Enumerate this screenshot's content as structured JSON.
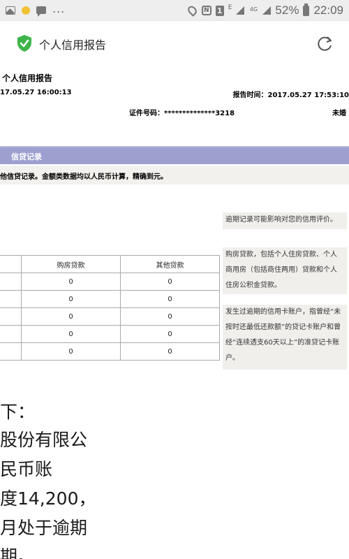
{
  "status_bar": {
    "battery_percent": "52%",
    "time": "22:09",
    "network": "4G",
    "extra_indicator": "E",
    "sim_indicator": "1",
    "more": "..."
  },
  "browser": {
    "page_title": "个人信用报告",
    "secure_color": "#3db54a"
  },
  "document": {
    "title": "个人信用报告",
    "query_time": "17.05.27 16:00:13",
    "report_time": "报告时间：2017.05.27 17:53:10",
    "id_number": "证件号码：**************3218",
    "marital_status": "未婚",
    "section_title": "信贷记录",
    "section_note": "他信贷记录。金额类数据均以人民币计算，精确到元。"
  },
  "side_notes": [
    "逾期记录可能影响对您的信用评价。",
    "购房贷款，包括个人住房贷款、个人商用房（包括商住两用）贷款和个人住房公积金贷款。",
    "发生过逾期的信用卡账户，指曾经“未按时还最低还款额”的贷记卡账户和曾经“连续透支60天以上”的准贷记卡账户。"
  ],
  "table": {
    "headers": [
      "",
      "购房贷款",
      "其他贷款"
    ],
    "rows": [
      [
        "",
        "0",
        "0"
      ],
      [
        "",
        "0",
        "0"
      ],
      [
        "",
        "0",
        "0"
      ],
      [
        "",
        "0",
        "0"
      ],
      [
        "",
        "0",
        "0"
      ]
    ]
  },
  "overlay_text": [
    "下：",
    "股份有限公",
    "民币账",
    "度14,200，",
    "月处于逾期",
    "期。"
  ]
}
